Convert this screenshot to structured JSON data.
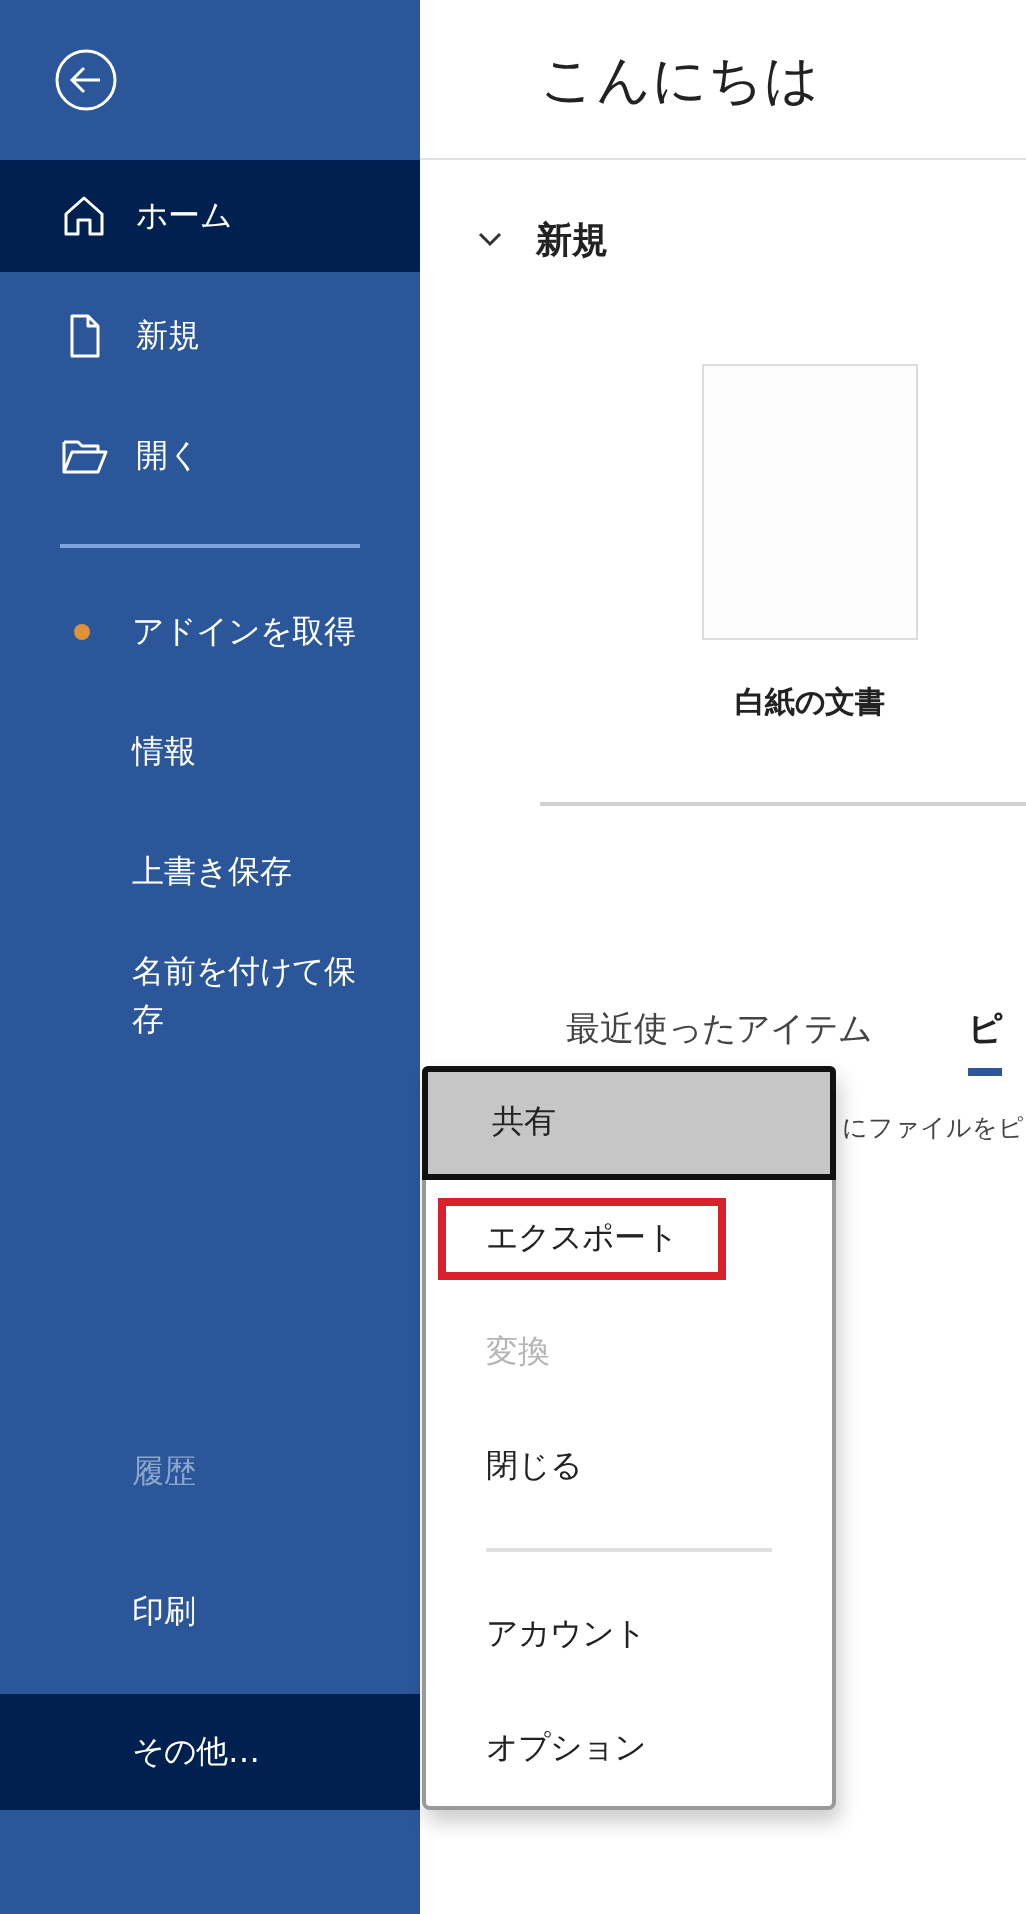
{
  "sidebar": {
    "top_items": [
      {
        "label": "ホーム",
        "selected": true
      },
      {
        "label": "新規",
        "selected": false
      },
      {
        "label": "開く",
        "selected": false
      }
    ],
    "items": [
      {
        "label": "アドインを取得",
        "notification": true,
        "disabled": false,
        "selected": false
      },
      {
        "label": "情報",
        "notification": false,
        "disabled": false,
        "selected": false
      },
      {
        "label": "上書き保存",
        "notification": false,
        "disabled": false,
        "selected": false
      },
      {
        "label": "名前を付けて保存",
        "notification": false,
        "disabled": false,
        "selected": false
      }
    ],
    "bottom_items": [
      {
        "label": "履歴",
        "disabled": true,
        "selected": false
      },
      {
        "label": "印刷",
        "disabled": false,
        "selected": false
      },
      {
        "label": "その他…",
        "disabled": false,
        "selected": true
      }
    ]
  },
  "header": {
    "title": "こんにちは"
  },
  "new_section": {
    "title": "新規",
    "expanded": true,
    "templates": [
      {
        "label": "白紙の文書"
      }
    ]
  },
  "tabs": [
    {
      "label": "最近使ったアイテム",
      "selected": false
    },
    {
      "label": "ピ",
      "selected": true
    }
  ],
  "hint": "にファイルをピ",
  "menu": {
    "items": [
      {
        "label": "共有",
        "selected": true,
        "disabled": false,
        "highlighted": false
      },
      {
        "label": "エクスポート",
        "selected": false,
        "disabled": false,
        "highlighted": true
      },
      {
        "label": "変換",
        "selected": false,
        "disabled": true,
        "highlighted": false
      },
      {
        "label": "閉じる",
        "selected": false,
        "disabled": false,
        "highlighted": false
      }
    ],
    "footer_items": [
      {
        "label": "アカウント",
        "selected": false,
        "disabled": false,
        "highlighted": false
      },
      {
        "label": "オプション",
        "selected": false,
        "disabled": false,
        "highlighted": false
      }
    ]
  }
}
